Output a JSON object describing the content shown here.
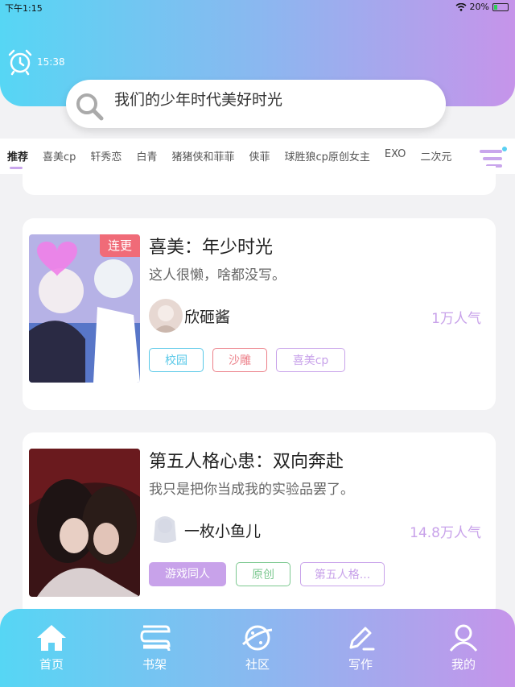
{
  "status_bar": {
    "time": "下午1:15",
    "battery": "20%"
  },
  "alarm_time": "15:38",
  "search": {
    "query": "我们的少年时代美好时光"
  },
  "tabs": [
    {
      "label": "推荐"
    },
    {
      "label": "喜美cp"
    },
    {
      "label": "轩秀恋"
    },
    {
      "label": "白青"
    },
    {
      "label": "猪猪侠和菲菲"
    },
    {
      "label": "侠菲"
    },
    {
      "label": "球胜狼cp原创女主"
    },
    {
      "label": "EXO"
    },
    {
      "label": "二次元"
    }
  ],
  "stories": [
    {
      "title": "喜美：年少时光",
      "desc": "这人很懒，啥都没写。",
      "author": "欣砸酱",
      "popularity": "1万人气",
      "badge": "连更",
      "tags": [
        "校园",
        "沙雕",
        "喜美cp"
      ]
    },
    {
      "title": "第五人格心患：双向奔赴",
      "desc": "我只是把你当成我的实验品罢了。",
      "author": "一枚小鱼儿",
      "popularity": "14.8万人气",
      "tags": [
        "游戏同人",
        "原创",
        "第五人格..."
      ]
    }
  ],
  "nav": [
    {
      "label": "首页"
    },
    {
      "label": "书架"
    },
    {
      "label": "社区"
    },
    {
      "label": "写作"
    },
    {
      "label": "我的"
    }
  ],
  "colors": {
    "accent": "#c694ea",
    "gradient_start": "#56d6f4",
    "badge": "#f06b78"
  }
}
